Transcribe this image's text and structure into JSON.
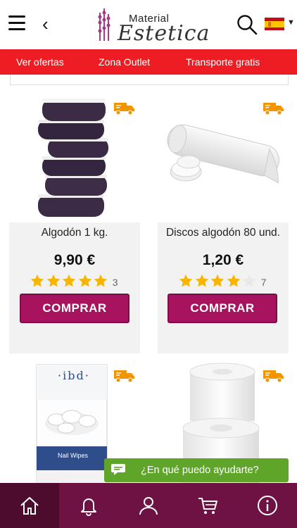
{
  "header": {
    "logo_line1": "Material",
    "logo_line2": "Estetica",
    "language": "es"
  },
  "promo_links": [
    "Ver ofertas",
    "Zona Outlet",
    "Transporte gratis"
  ],
  "products": [
    {
      "name": "Algodón 1 kg.",
      "price": "9,90 €",
      "rating": 5,
      "reviews": "3",
      "button": "COMPRAR",
      "free_shipping_icon": "truck-icon"
    },
    {
      "name": "Discos algodón 80 und.",
      "price": "1,20 €",
      "rating": 4,
      "reviews": "7",
      "button": "COMPRAR",
      "free_shipping_icon": "truck-icon"
    },
    {
      "name": "",
      "brand_label": "·ibd·",
      "pack_text": "Nail Wipes",
      "free_shipping_icon": "truck-icon"
    },
    {
      "name": "",
      "free_shipping_icon": "truck-icon"
    }
  ],
  "chat": {
    "label": "¿En qué puedo ayudarte?"
  },
  "tabbar": {
    "items": [
      "home-icon",
      "bell-icon",
      "user-icon",
      "cart-icon",
      "info-icon"
    ],
    "active": 0
  },
  "colors": {
    "accent": "#a8135f",
    "promo_bar": "#ee1d23",
    "tabbar": "#6e1143",
    "chat": "#5ea52a",
    "star": "#f7b500"
  }
}
